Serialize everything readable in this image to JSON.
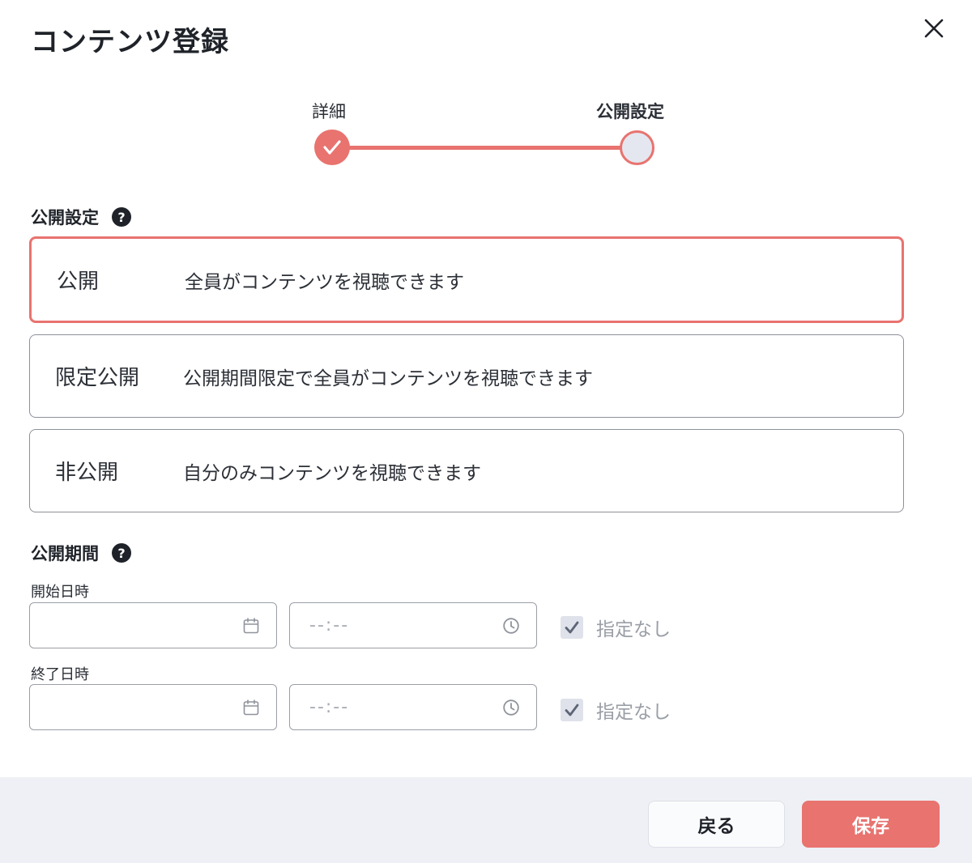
{
  "dialog": {
    "title": "コンテンツ登録"
  },
  "stepper": {
    "steps": [
      {
        "label": "詳細",
        "state": "completed"
      },
      {
        "label": "公開設定",
        "state": "current"
      }
    ]
  },
  "visibility": {
    "section_label": "公開設定",
    "help_symbol": "?",
    "selected": "公開",
    "options": [
      {
        "name": "公開",
        "description": "全員がコンテンツを視聴できます"
      },
      {
        "name": "限定公開",
        "description": "公開期間限定で全員がコンテンツを視聴できます"
      },
      {
        "name": "非公開",
        "description": "自分のみコンテンツを視聴できます"
      }
    ]
  },
  "period": {
    "section_label": "公開期間",
    "help_symbol": "?",
    "start": {
      "label": "開始日時",
      "date_value": "",
      "time_placeholder": "--:--",
      "unspecified_label": "指定なし",
      "unspecified_checked": true
    },
    "end": {
      "label": "終了日時",
      "date_value": "",
      "time_placeholder": "--:--",
      "unspecified_label": "指定なし",
      "unspecified_checked": true
    }
  },
  "footer": {
    "back_label": "戻る",
    "save_label": "保存"
  },
  "colors": {
    "accent": "#e8736f",
    "text": "#1f2329",
    "footer_bg": "#eef0f5",
    "disabled_text": "#9a9ea6"
  },
  "icons": {
    "close": "close-icon",
    "check": "check-icon",
    "help": "help-icon",
    "calendar": "calendar-icon",
    "clock": "clock-icon"
  }
}
